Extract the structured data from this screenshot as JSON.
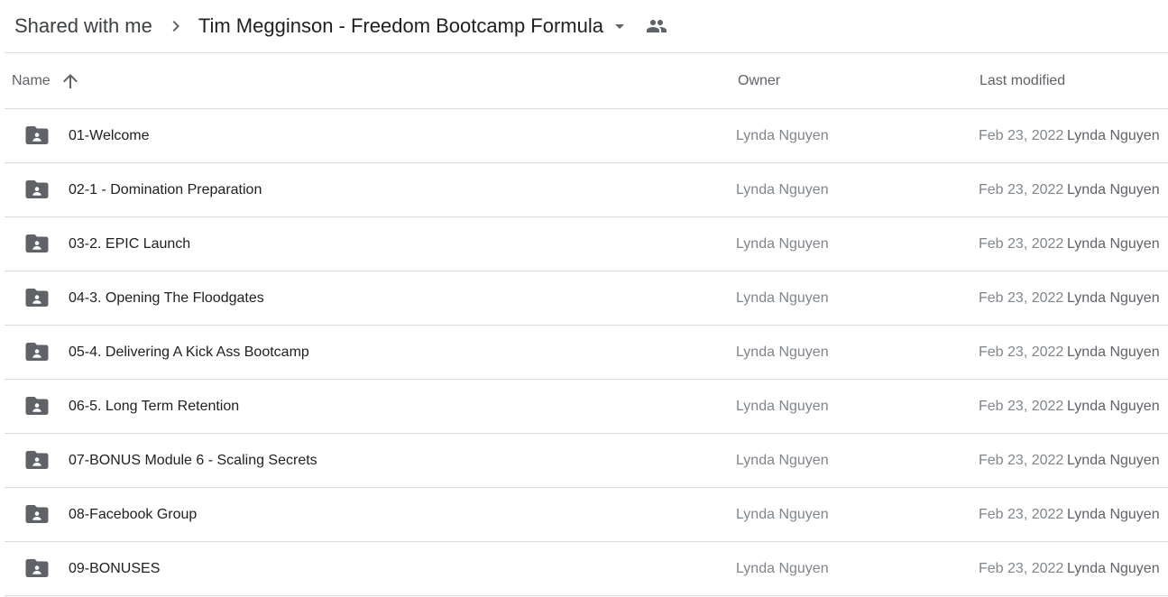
{
  "breadcrumb": {
    "parent": "Shared with me",
    "current": "Tim Megginson - Freedom Bootcamp Formula"
  },
  "columns": {
    "name": "Name",
    "owner": "Owner",
    "last_modified": "Last modified"
  },
  "icons": {
    "separator": "chevron-right-icon",
    "dropdown": "arrow-drop-down-icon",
    "shared": "people-icon",
    "sort": "arrow-upward-icon",
    "folder": "shared-folder-icon"
  },
  "colors": {
    "icon_gray": "#5f6368",
    "divider": "#dadce0"
  },
  "rows": [
    {
      "name": "01-Welcome",
      "owner": "Lynda Nguyen",
      "modified_date": "Feb 23, 2022",
      "modified_by": "Lynda Nguyen"
    },
    {
      "name": "02-1 - Domination Preparation",
      "owner": "Lynda Nguyen",
      "modified_date": "Feb 23, 2022",
      "modified_by": "Lynda Nguyen"
    },
    {
      "name": "03-2. EPIC Launch",
      "owner": "Lynda Nguyen",
      "modified_date": "Feb 23, 2022",
      "modified_by": "Lynda Nguyen"
    },
    {
      "name": "04-3. Opening The Floodgates",
      "owner": "Lynda Nguyen",
      "modified_date": "Feb 23, 2022",
      "modified_by": "Lynda Nguyen"
    },
    {
      "name": "05-4. Delivering A Kick Ass Bootcamp",
      "owner": "Lynda Nguyen",
      "modified_date": "Feb 23, 2022",
      "modified_by": "Lynda Nguyen"
    },
    {
      "name": "06-5. Long Term Retention",
      "owner": "Lynda Nguyen",
      "modified_date": "Feb 23, 2022",
      "modified_by": "Lynda Nguyen"
    },
    {
      "name": "07-BONUS Module 6 - Scaling Secrets",
      "owner": "Lynda Nguyen",
      "modified_date": "Feb 23, 2022",
      "modified_by": "Lynda Nguyen"
    },
    {
      "name": "08-Facebook Group",
      "owner": "Lynda Nguyen",
      "modified_date": "Feb 23, 2022",
      "modified_by": "Lynda Nguyen"
    },
    {
      "name": "09-BONUSES",
      "owner": "Lynda Nguyen",
      "modified_date": "Feb 23, 2022",
      "modified_by": "Lynda Nguyen"
    }
  ]
}
